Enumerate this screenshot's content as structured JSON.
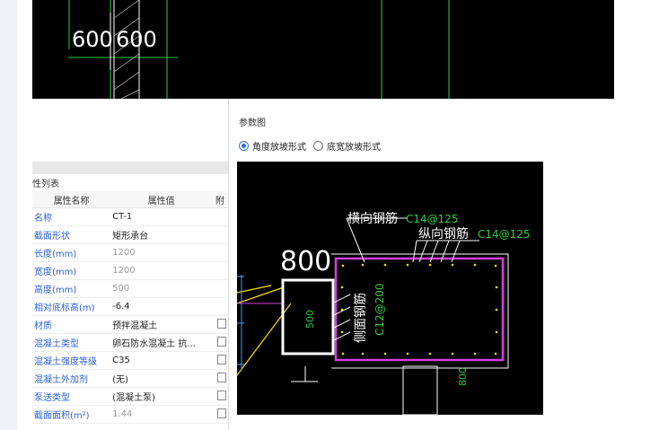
{
  "top_canvas": {
    "dim_left": "600",
    "dim_right": "600"
  },
  "property_panel": {
    "title": "性列表",
    "col_name": "属性名称",
    "col_value": "属性值",
    "col_attach": "附",
    "rows": [
      {
        "name": "名称",
        "value": "CT-1"
      },
      {
        "name": "截面形状",
        "value": "矩形承台"
      },
      {
        "name": "长度(mm)",
        "value": "1200"
      },
      {
        "name": "宽度(mm)",
        "value": "1200"
      },
      {
        "name": "高度(mm)",
        "value": "500"
      },
      {
        "name": "相对底标高(m)",
        "value": "-6.4"
      },
      {
        "name": "材质",
        "value": "预拌混凝土"
      },
      {
        "name": "混凝土类型",
        "value": "卵石防水混凝土 抗..."
      },
      {
        "name": "混凝土强度等级",
        "value": "C35"
      },
      {
        "name": "混凝土外加剂",
        "value": "(无)"
      },
      {
        "name": "泵送类型",
        "value": "(混凝土泵)"
      },
      {
        "name": "截面面积(m²)",
        "value": "1.44"
      }
    ]
  },
  "param_panel": {
    "title": "参数图",
    "radio_angle": "角度放坡形式",
    "radio_width": "底宽放坡形式"
  },
  "diagram": {
    "width_800": "800",
    "transverse_label": "横向钢筋",
    "transverse_value": "C14@125",
    "longitudinal_label": "纵向钢筋",
    "longitudinal_value": "C14@125",
    "side_label": "侧面钢筋",
    "side_value": "C12@200",
    "dim_500": "500",
    "dim_800_bottom": "800"
  }
}
